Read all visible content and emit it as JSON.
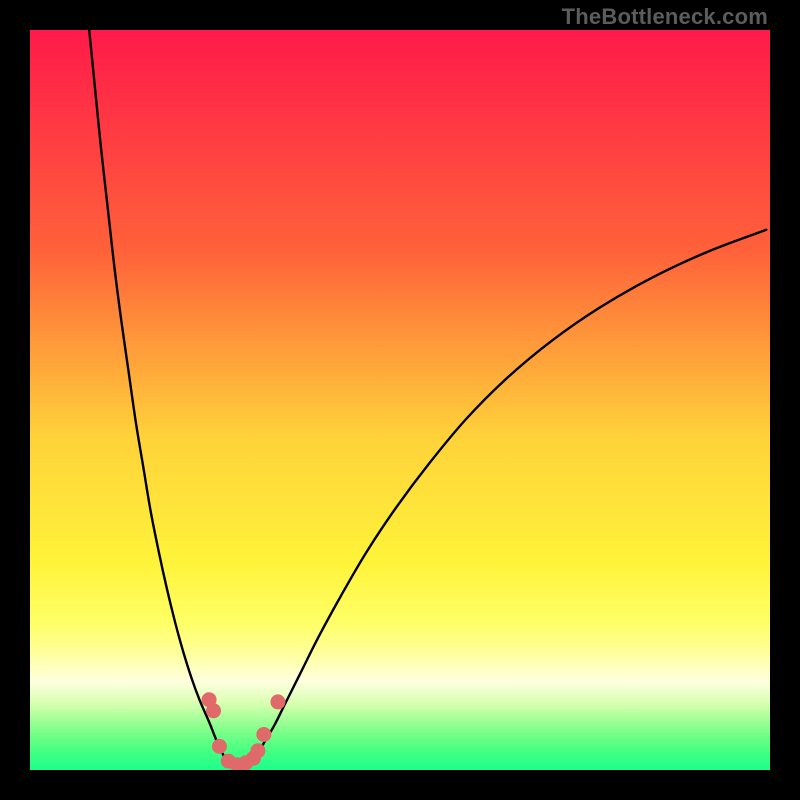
{
  "watermark": "TheBottleneck.com",
  "chart_data": {
    "type": "line",
    "title": "",
    "xlabel": "",
    "ylabel": "",
    "xlim": [
      0,
      100
    ],
    "ylim": [
      0,
      100
    ],
    "gradient_stops": [
      {
        "offset": 0,
        "color": "#ff1a4a"
      },
      {
        "offset": 0.3,
        "color": "#ff623a"
      },
      {
        "offset": 0.55,
        "color": "#ffd23a"
      },
      {
        "offset": 0.72,
        "color": "#fff33a"
      },
      {
        "offset": 0.8,
        "color": "#ffff66"
      },
      {
        "offset": 0.84,
        "color": "#ffff99"
      },
      {
        "offset": 0.88,
        "color": "#ffffe0"
      },
      {
        "offset": 0.91,
        "color": "#d8ffb0"
      },
      {
        "offset": 0.94,
        "color": "#8fff8f"
      },
      {
        "offset": 0.97,
        "color": "#4dff80"
      },
      {
        "offset": 1.0,
        "color": "#1aff8c"
      }
    ],
    "series": [
      {
        "name": "left-branch",
        "x": [
          8.0,
          8.8,
          9.6,
          10.5,
          11.4,
          12.3,
          13.3,
          14.3,
          15.3,
          16.3,
          17.4,
          18.5,
          19.6,
          20.7,
          21.8,
          22.9,
          24.2,
          25.2,
          25.9
        ],
        "y": [
          100,
          92,
          84,
          76,
          68,
          61,
          54,
          47,
          41,
          35,
          29.5,
          24.5,
          20,
          16,
          12.5,
          9.5,
          6.5,
          4,
          2.5
        ]
      },
      {
        "name": "right-branch",
        "x": [
          31.0,
          31.8,
          33.0,
          34.5,
          36.5,
          39.0,
          42.0,
          45.5,
          49.5,
          54.0,
          59.0,
          64.5,
          70.5,
          77.0,
          84.0,
          91.5,
          99.5
        ],
        "y": [
          2.5,
          4,
          6,
          9,
          13,
          18,
          23.5,
          29.5,
          35.5,
          41.5,
          47.5,
          53.0,
          58.0,
          62.5,
          66.5,
          70.0,
          73.0
        ]
      },
      {
        "name": "trough",
        "x": [
          25.9,
          26.5,
          27.2,
          28.0,
          28.8,
          29.6,
          30.3,
          31.0
        ],
        "y": [
          2.5,
          1.3,
          0.7,
          0.4,
          0.7,
          1.3,
          2.0,
          2.5
        ]
      }
    ],
    "markers": [
      {
        "x": 24.2,
        "y": 9.5
      },
      {
        "x": 24.8,
        "y": 8.0
      },
      {
        "x": 25.6,
        "y": 3.2
      },
      {
        "x": 26.8,
        "y": 1.2
      },
      {
        "x": 28.0,
        "y": 0.7
      },
      {
        "x": 29.2,
        "y": 1.0
      },
      {
        "x": 30.2,
        "y": 1.6
      },
      {
        "x": 30.8,
        "y": 2.6
      },
      {
        "x": 31.6,
        "y": 4.8
      },
      {
        "x": 33.5,
        "y": 9.2
      }
    ],
    "marker_color": "#e06a6a",
    "curve_color": "#000000"
  }
}
